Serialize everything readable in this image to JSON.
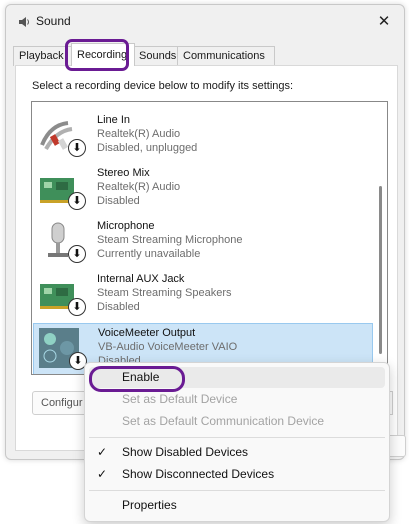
{
  "window": {
    "title": "Sound",
    "close_glyph": "✕",
    "icon": "speaker-icon"
  },
  "tabs": [
    {
      "label": "Playback",
      "active": false
    },
    {
      "label": "Recording",
      "active": true
    },
    {
      "label": "Sounds",
      "active": false
    },
    {
      "label": "Communications",
      "active": false
    }
  ],
  "instruction": "Select a recording device below to modify its settings:",
  "devices": [
    {
      "name": "Line In",
      "subtitle": "Realtek(R) Audio",
      "status": "Disabled, unplugged",
      "icon": "line-in-icon",
      "selected": false
    },
    {
      "name": "Stereo Mix",
      "subtitle": "Realtek(R) Audio",
      "status": "Disabled",
      "icon": "sound-card-icon",
      "selected": false
    },
    {
      "name": "Microphone",
      "subtitle": "Steam Streaming Microphone",
      "status": "Currently unavailable",
      "icon": "microphone-icon",
      "selected": false
    },
    {
      "name": "Internal AUX Jack",
      "subtitle": "Steam Streaming Speakers",
      "status": "Disabled",
      "icon": "sound-card-icon",
      "selected": false
    },
    {
      "name": "VoiceMeeter Output",
      "subtitle": "VB-Audio VoiceMeeter VAIO",
      "status": "Disabled",
      "icon": "voicemeeter-icon",
      "selected": true
    }
  ],
  "disabled_badge_glyph": "⬇",
  "configure_label": "Configur",
  "context_menu": {
    "items": [
      {
        "label": "Enable",
        "enabled": true,
        "checked": false
      },
      {
        "label": "Set as Default Device",
        "enabled": false,
        "checked": false
      },
      {
        "label": "Set as Default Communication Device",
        "enabled": false,
        "checked": false
      },
      {
        "label": "Show Disabled Devices",
        "enabled": true,
        "checked": true
      },
      {
        "label": "Show Disconnected Devices",
        "enabled": true,
        "checked": true
      },
      {
        "label": "Properties",
        "enabled": true,
        "checked": false
      }
    ],
    "check_glyph": "✓"
  },
  "colors": {
    "annotation": "#6a1b93",
    "selection": "#cce4f7"
  }
}
